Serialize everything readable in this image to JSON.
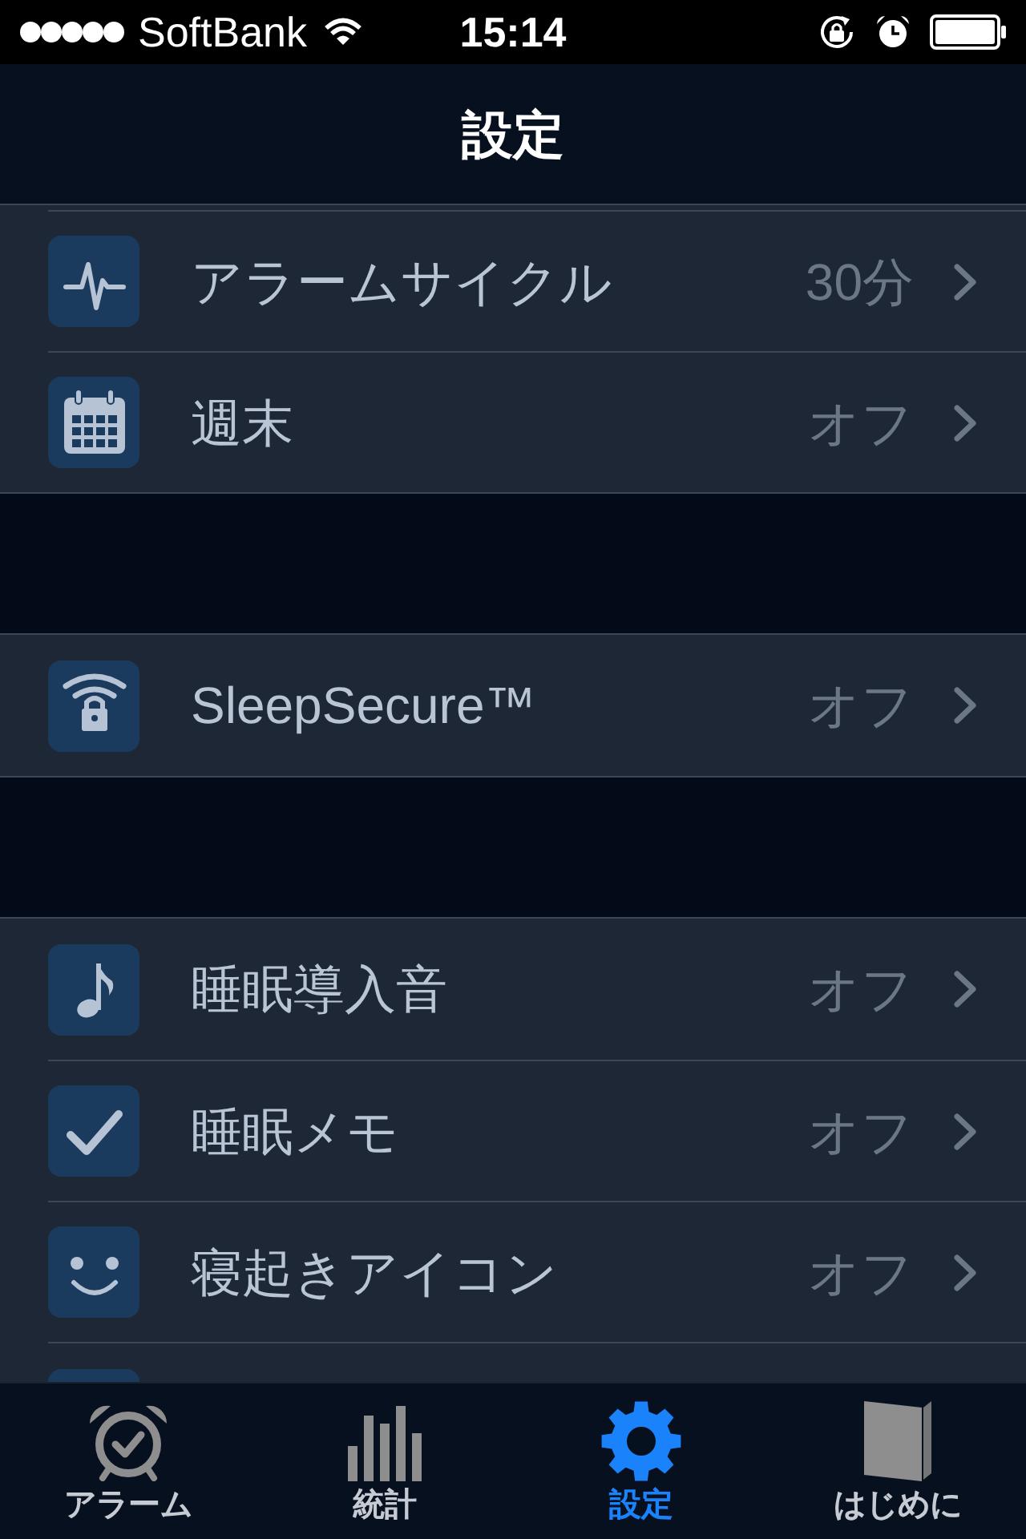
{
  "status_bar": {
    "carrier": "SoftBank",
    "time": "15:14"
  },
  "nav_bar": {
    "title": "設定"
  },
  "sections": [
    {
      "rows": [
        {
          "kind": "pulse",
          "label": "アラームサイクル",
          "value": "30分"
        },
        {
          "kind": "calendar",
          "label": "週末",
          "value": "オフ"
        }
      ]
    },
    {
      "rows": [
        {
          "kind": "wifi-lock",
          "label": "SleepSecure™",
          "value": "オフ"
        }
      ]
    },
    {
      "rows": [
        {
          "kind": "note",
          "label": "睡眠導入音",
          "value": "オフ"
        },
        {
          "kind": "check",
          "label": "睡眠メモ",
          "value": "オフ"
        },
        {
          "kind": "smile",
          "label": "寝起きアイコン",
          "value": "オフ"
        }
      ]
    }
  ],
  "tab_bar": {
    "tabs": [
      {
        "kind": "alarm",
        "label": "アラーム",
        "selected": false
      },
      {
        "kind": "stats",
        "label": "統計",
        "selected": false
      },
      {
        "kind": "settings",
        "label": "設定",
        "selected": true
      },
      {
        "kind": "book",
        "label": "はじめに",
        "selected": false
      }
    ]
  }
}
